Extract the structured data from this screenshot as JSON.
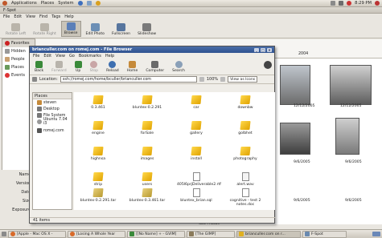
{
  "top_panel": {
    "menus": [
      "Applications",
      "Places",
      "System"
    ],
    "clock": "8:29 PM"
  },
  "fspot": {
    "title": "F-Spot",
    "menu": [
      "File",
      "Edit",
      "View",
      "Find",
      "Tags",
      "Help"
    ],
    "toolbar": [
      "Rotate Left",
      "Rotate Right",
      "Browse",
      "Edit Photo",
      "Fullscreen",
      "Slideshow"
    ],
    "sidebar": [
      "Favorites",
      "Hidden",
      "People",
      "Places",
      "Events"
    ],
    "info_labels": [
      "Name:",
      "Version:",
      "Date:",
      "Size:",
      "Exposure:"
    ],
    "timeline_year": "2004",
    "captions": [
      "12/12/2005",
      "12/12/2005",
      "12/12/2005",
      "9/6/2005",
      "9/6/2005",
      "9/6/2005",
      "9/6/2005",
      "9/6/2005",
      "9/6/2005"
    ],
    "status": "486 Photos"
  },
  "browser": {
    "title": "brianculler.com on romej.com - File Browser",
    "menu": [
      "File",
      "Edit",
      "View",
      "Go",
      "Bookmarks",
      "Help"
    ],
    "toolbar": [
      "Back",
      "Forward",
      "Up",
      "Stop",
      "Reload",
      "Home",
      "Computer",
      "Search"
    ],
    "location_label": "Location:",
    "location_value": "ssh://romej.com/home/bculler/brianculler.com",
    "zoom": "100%",
    "view_mode": "View as Icons",
    "places_header": "Places",
    "places": [
      "steven",
      "Desktop",
      "File System",
      "Ubuntu 7.04 i3",
      "romej.com"
    ],
    "files": [
      "0.3.461",
      "bluntex-0.2.291",
      "car",
      "downbw",
      "engine",
      "forSale",
      "gallery",
      "golbhet",
      "highnsa",
      "images",
      "install",
      "photography",
      "strip",
      "users",
      "405l6prjDeliverable2.rtf",
      "alert.wav",
      "bluntex-0.2.291.tar",
      "bluntex-0.3.461.tar",
      "bluntex_brian.sql",
      "cognitive - test 2 notes.doc"
    ],
    "status": "41 items"
  },
  "taskbar": [
    "[Apple - Mac OS X -",
    "[Losing A Whole Year",
    "[[No Name] + - GVIM]",
    "[The GIMP]",
    "brianculler.com on r...",
    "F-Spot"
  ],
  "colors": {
    "folder": "#f2c21e",
    "titlebar_active": "#2f5290"
  }
}
